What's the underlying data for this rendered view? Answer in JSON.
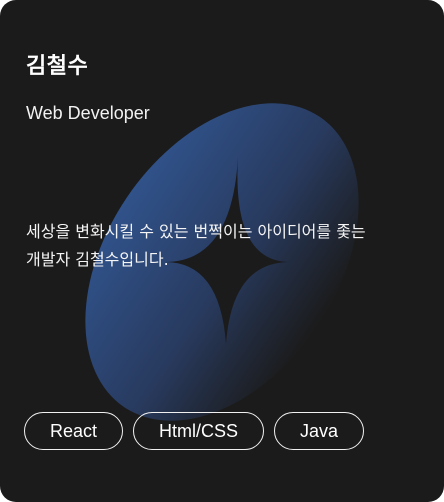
{
  "profile": {
    "name": "김철수",
    "role": "Web Developer",
    "description": "세상을 변화시킬 수 있는  번쩍이는 아이디어를 좇는\n개발자 김철수입니다."
  },
  "tags": [
    {
      "label": "React"
    },
    {
      "label": "Html/CSS"
    },
    {
      "label": "Java"
    }
  ],
  "colors": {
    "card_background": "#1b1b1b",
    "graphic_top": "#2f4f86",
    "graphic_bottom": "#1b1b1b",
    "text": "#ffffff"
  },
  "icons": {
    "background": "sparkle-star-ellipse-graphic"
  }
}
